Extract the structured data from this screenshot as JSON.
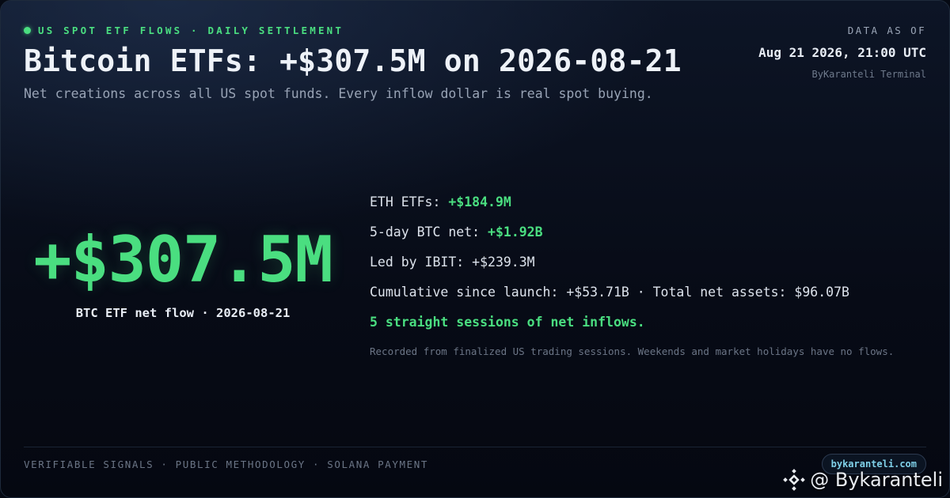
{
  "header": {
    "eyebrow": "US SPOT ETF FLOWS · DAILY SETTLEMENT",
    "title": "Bitcoin ETFs: +$307.5M on 2026-08-21",
    "subtitle": "Net creations across all US spot funds. Every inflow dollar is real spot buying."
  },
  "as_of": {
    "label": "DATA AS OF",
    "timestamp": "Aug 21 2026, 21:00 UTC",
    "source": "ByKaranteli Terminal"
  },
  "hero": {
    "value": "+$307.5M",
    "caption": "BTC ETF net flow · 2026-08-21"
  },
  "stats": {
    "eth_label": "ETH ETFs: ",
    "eth_value": "+$184.9M",
    "five_day_label": "5-day BTC net: ",
    "five_day_value": "+$1.92B",
    "led_by": "Led by IBIT: +$239.3M",
    "cumulative": "Cumulative since launch: +$53.71B · Total net assets: $96.07B",
    "streak": "5 straight sessions of net inflows.",
    "note": "Recorded from finalized US trading sessions. Weekends and market holidays have no flows."
  },
  "footer": {
    "tagline": "VERIFIABLE SIGNALS · PUBLIC METHODOLOGY · SOLANA PAYMENT",
    "site": "bykaranteli.com"
  },
  "watermark": {
    "handle": "@ Bykaranteli",
    "icon": "binance-logo-icon"
  },
  "colors": {
    "accent_green": "#4ade80",
    "background": "#070b16",
    "site_link": "#7fd0e8"
  }
}
